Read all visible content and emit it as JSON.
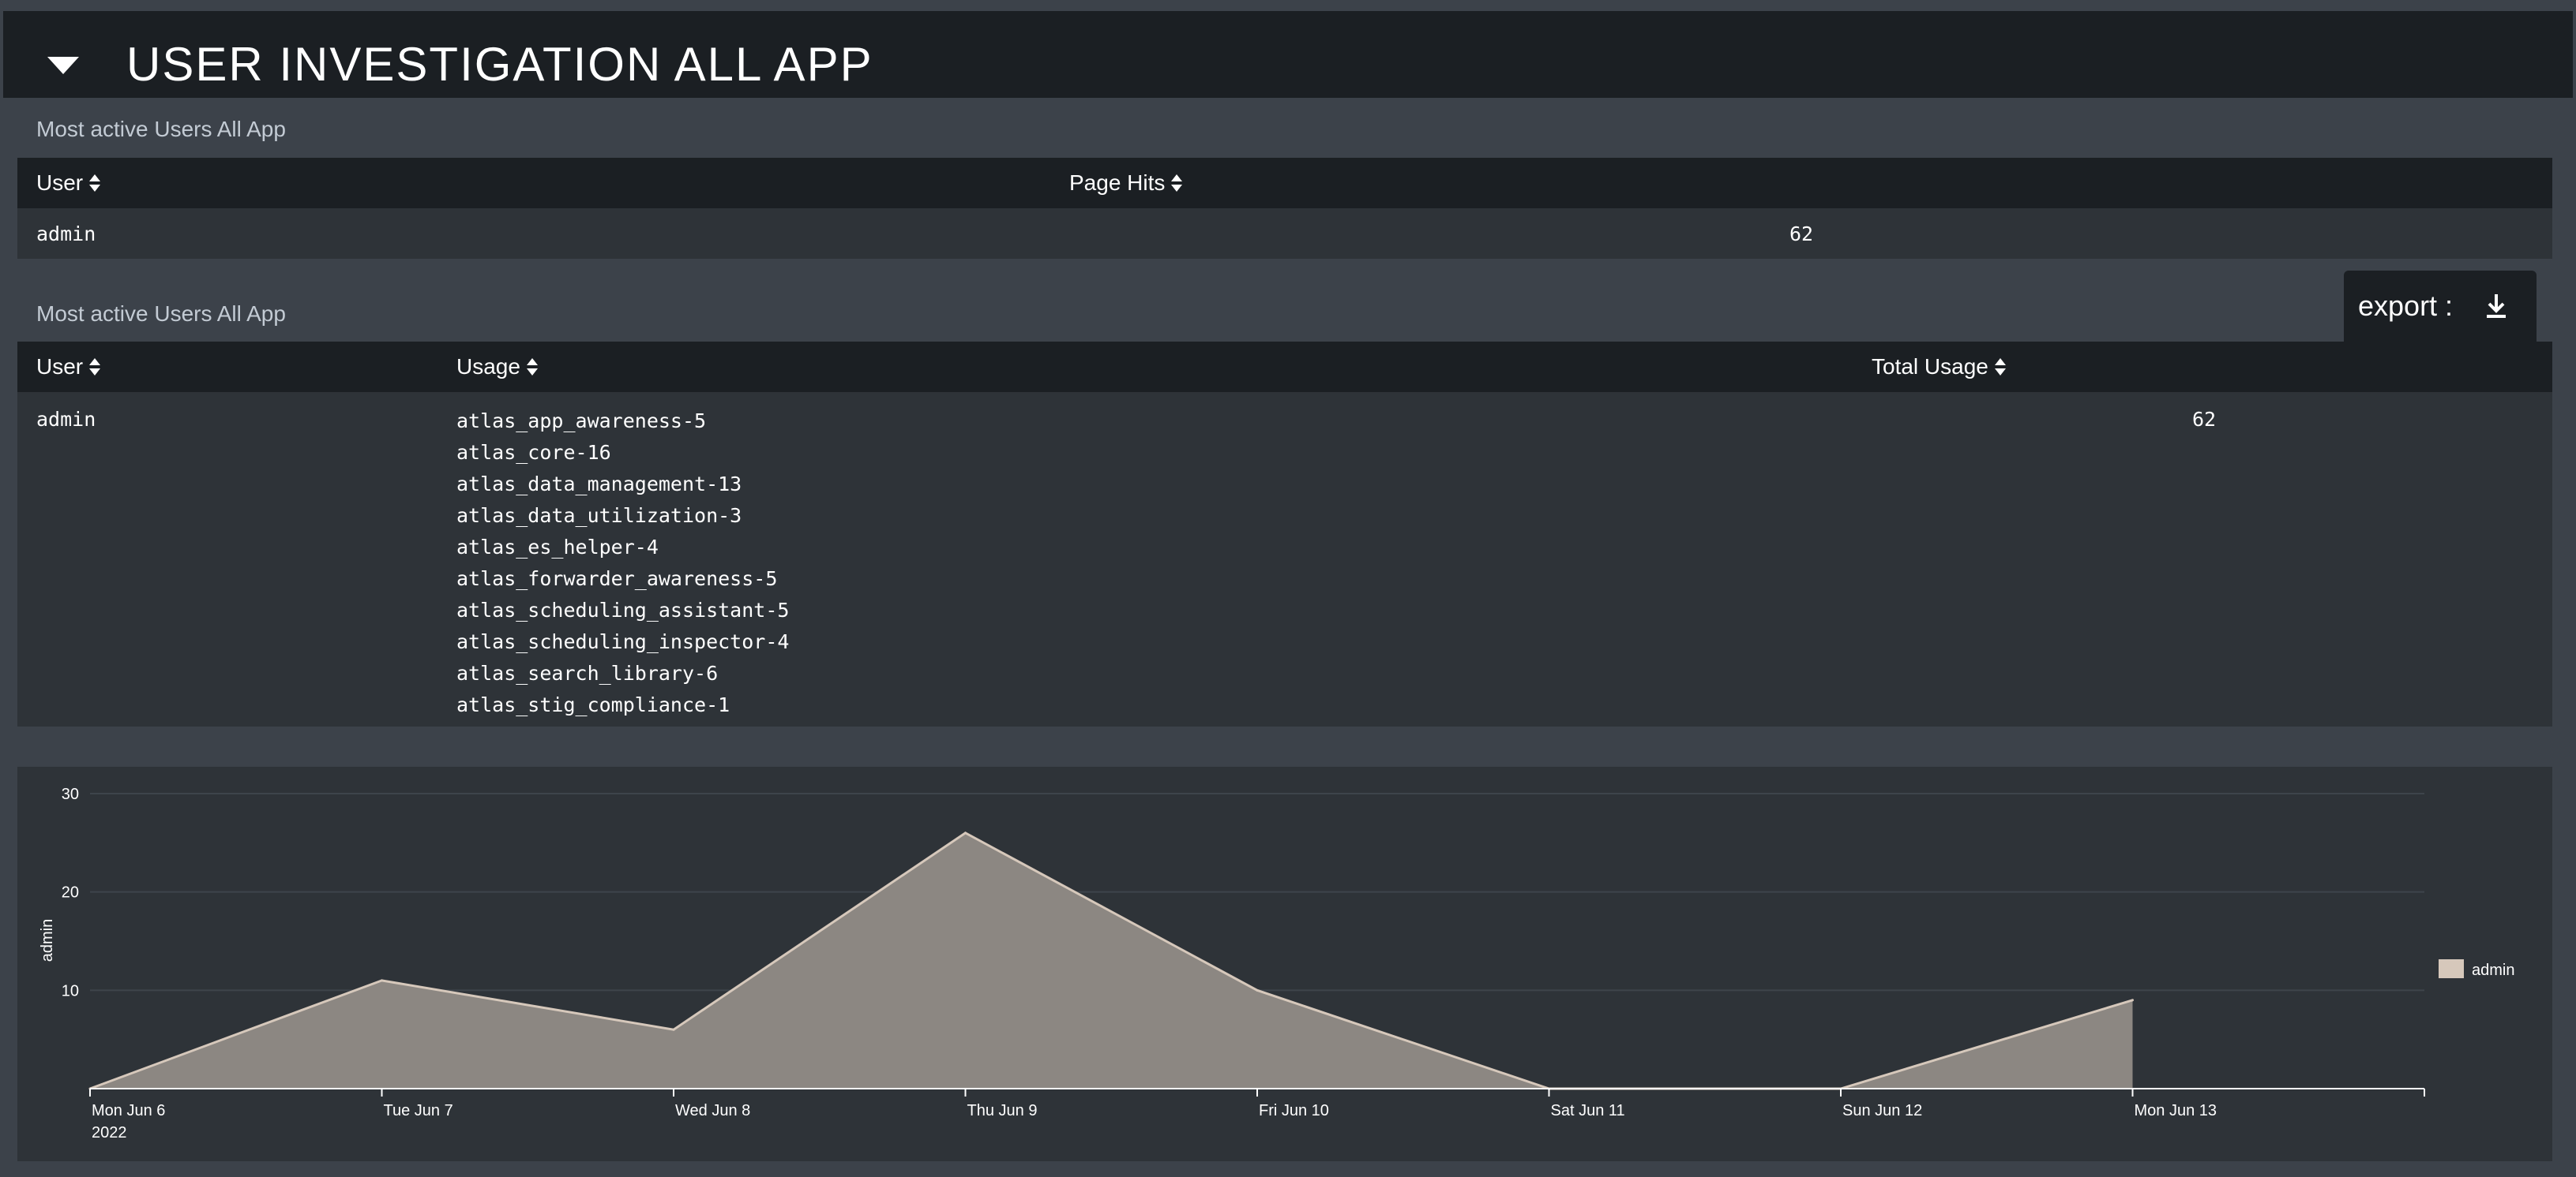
{
  "header": {
    "title": "USER INVESTIGATION ALL APP"
  },
  "panel1": {
    "title": "Most active Users All App",
    "columns": [
      "User",
      "Page Hits"
    ],
    "rows": [
      {
        "user": "admin",
        "page_hits": "62"
      }
    ]
  },
  "panel2": {
    "title": "Most active Users All App",
    "export_label": "export :",
    "columns": [
      "User",
      "Usage",
      "Total Usage"
    ],
    "rows": [
      {
        "user": "admin",
        "usage": [
          "atlas_app_awareness-5",
          "atlas_core-16",
          "atlas_data_management-13",
          "atlas_data_utilization-3",
          "atlas_es_helper-4",
          "atlas_forwarder_awareness-5",
          "atlas_scheduling_assistant-5",
          "atlas_scheduling_inspector-4",
          "atlas_search_library-6",
          "atlas_stig_compliance-1"
        ],
        "total_usage": "62"
      }
    ]
  },
  "chart_data": {
    "type": "area",
    "ylabel": "admin",
    "xlabel": "",
    "year_label": "2022",
    "categories": [
      "Mon Jun 6",
      "Tue Jun 7",
      "Wed Jun 8",
      "Thu Jun 9",
      "Fri Jun 10",
      "Sat Jun 11",
      "Sun Jun 12",
      "Mon Jun 13"
    ],
    "y_ticks": [
      "10",
      "20",
      "30"
    ],
    "ylim": [
      0,
      30
    ],
    "series": [
      {
        "name": "admin",
        "values": [
          0,
          11,
          6,
          26,
          10,
          0,
          0,
          9
        ],
        "color": "#d6c8bb"
      }
    ],
    "legend": "right",
    "grid": true,
    "area_fill": "#8c8782"
  }
}
